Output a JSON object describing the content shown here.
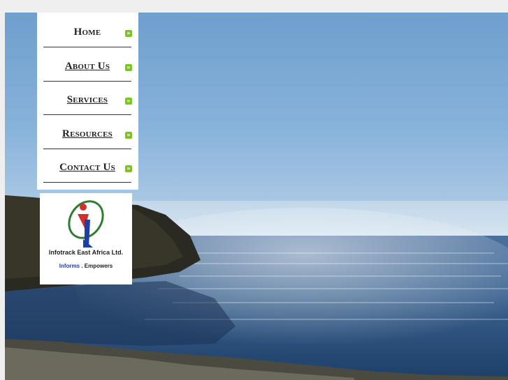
{
  "nav": {
    "items": [
      {
        "label": "Home"
      },
      {
        "label": "About Us"
      },
      {
        "label": "Services"
      },
      {
        "label": "Resources"
      },
      {
        "label": "Contact Us"
      }
    ],
    "arrow_glyph": "»",
    "accent_color": "#7cc520"
  },
  "logo": {
    "name": "Infotrack East Africa Ltd.",
    "tag_informs": "Informs",
    "tag_sep": ".",
    "tag_empowers": "Empowers"
  },
  "icons": {
    "nav_arrow": "double-chevron-right-icon",
    "logo_mark": "infotrack-logo-icon"
  }
}
